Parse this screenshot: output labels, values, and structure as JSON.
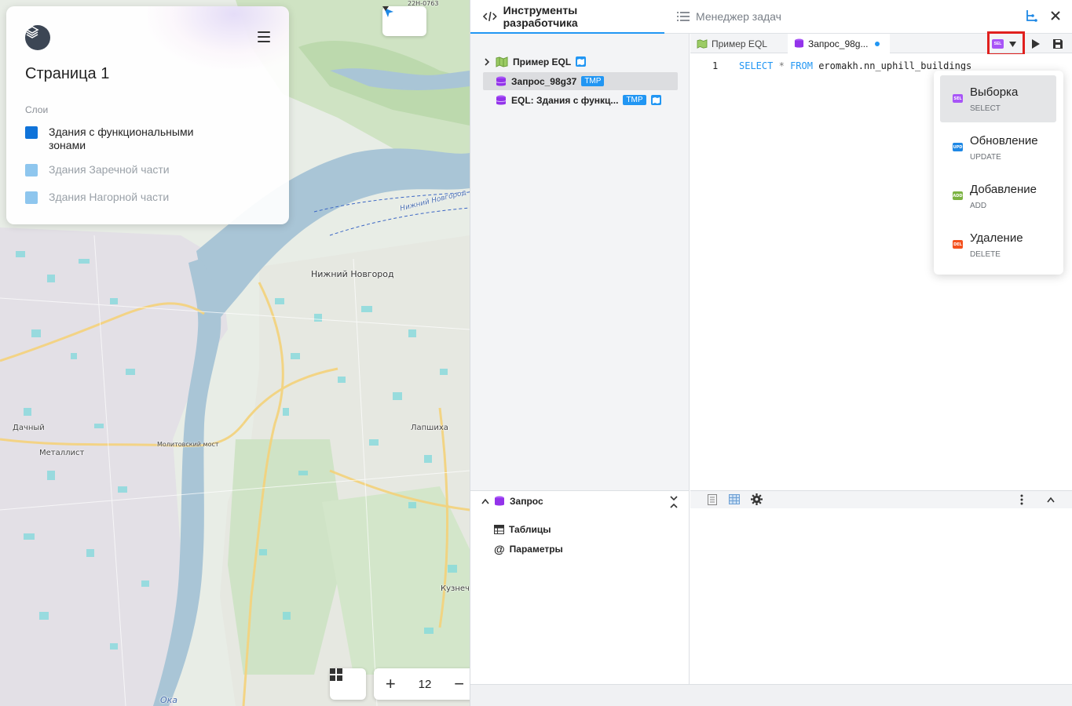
{
  "map": {
    "labels": [
      {
        "text": "Нижний Новгород",
        "kind": "city"
      },
      {
        "text": "Дачный",
        "kind": "place"
      },
      {
        "text": "Металлист",
        "kind": "place"
      },
      {
        "text": "Лапшиха",
        "kind": "place"
      },
      {
        "text": "Кузнечих",
        "kind": "place"
      },
      {
        "text": "Ока",
        "kind": "river"
      },
      {
        "text": "Нижний Новгород - Бор",
        "kind": "river"
      },
      {
        "text": "Молитовский мост",
        "kind": "road"
      },
      {
        "text": "22Н-0763",
        "kind": "road"
      }
    ],
    "zoom_level": "12",
    "zoom_in_icon": "plus-icon",
    "zoom_out_icon": "minus-icon"
  },
  "layers_panel": {
    "page_title": "Страница 1",
    "layers_heading": "Слои",
    "layers": [
      {
        "label": "Здания с функциональными зонами",
        "color": "#0f73d9",
        "active": true
      },
      {
        "label": "Здания Заречной части",
        "color": "#8ec6ee",
        "active": false
      },
      {
        "label": "Здания Нагорной части",
        "color": "#8ec6ee",
        "active": false
      }
    ]
  },
  "dev_panel": {
    "tabs": [
      {
        "label": "Инструменты разработчика",
        "icon": "code-icon",
        "active": true
      },
      {
        "label": "Менеджер задач",
        "icon": "list-icon",
        "active": false
      }
    ],
    "tree": [
      {
        "label": "Пример EQL",
        "icon": "map-icon",
        "tmp": "",
        "expandable": true
      },
      {
        "label": "Запрос_98g37",
        "icon": "database-icon",
        "tmp": "TMP",
        "selected": true
      },
      {
        "label": "EQL: Здания с функц...",
        "icon": "database-icon",
        "tmp": "TMP"
      }
    ],
    "editor_tabs": [
      {
        "label": "Пример EQL",
        "icon": "map-icon",
        "active": false
      },
      {
        "label": "Запрос_98g...",
        "icon": "database-icon",
        "active": true,
        "modified": true
      }
    ],
    "code": {
      "line_number": "1",
      "keyword1": "SELECT",
      "operator": "*",
      "keyword2": "FROM",
      "identifier": "eromakh.nn_uphill_buildings"
    },
    "query_type_menu": [
      {
        "title": "Выборка",
        "subtitle": "SELECT",
        "badge": "SEL",
        "color": "#a855f7",
        "highlighted": true
      },
      {
        "title": "Обновление",
        "subtitle": "UPDATE",
        "badge": "UPD",
        "color": "#1e88e5",
        "highlighted": false
      },
      {
        "title": "Добавление",
        "subtitle": "ADD",
        "badge": "ADD",
        "color": "#7cb342",
        "highlighted": false
      },
      {
        "title": "Удаление",
        "subtitle": "DELETE",
        "badge": "DEL",
        "color": "#f4511e",
        "highlighted": false
      }
    ],
    "current_query_badge": "SEL",
    "bottom": {
      "section": "Запрос",
      "items": [
        {
          "label": "Таблицы",
          "icon": "table-icon"
        },
        {
          "label": "Параметры",
          "icon": "at-icon"
        }
      ]
    }
  }
}
